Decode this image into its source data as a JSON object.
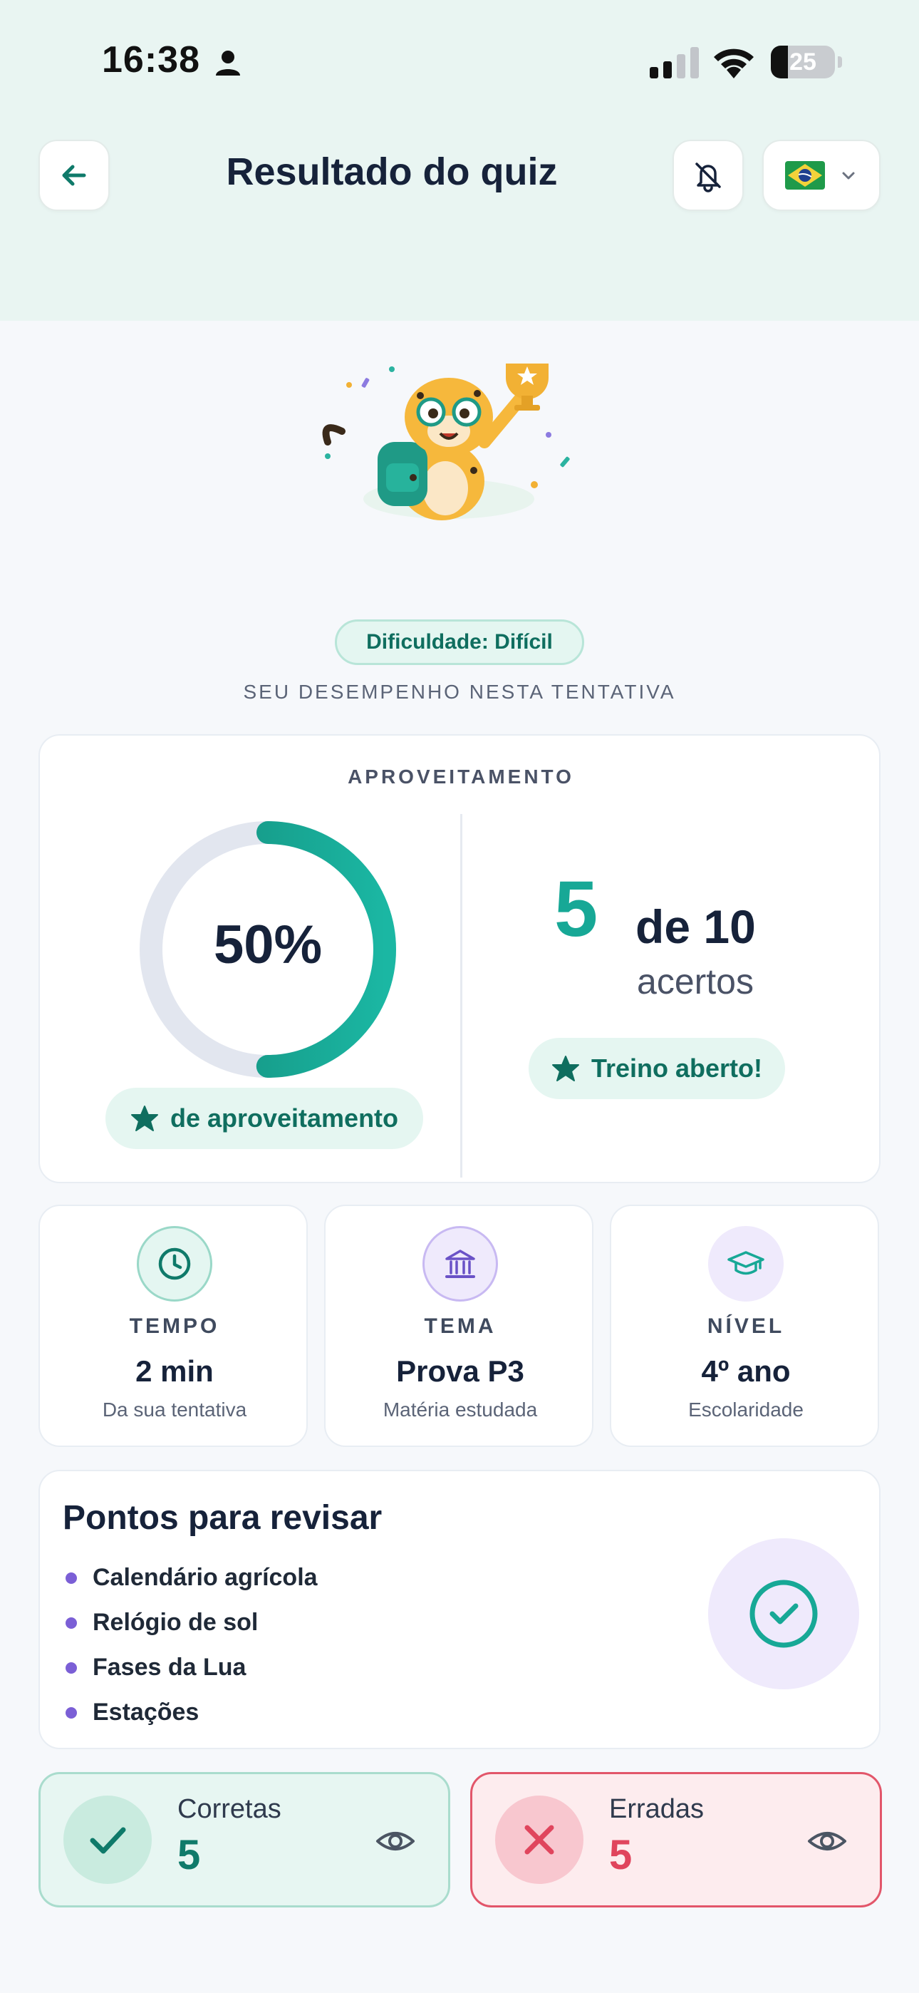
{
  "status_bar": {
    "time": "16:38",
    "battery": "25",
    "icons": [
      "person-icon",
      "signal-icon",
      "wifi-icon",
      "battery-icon"
    ]
  },
  "header": {
    "title": "Resultado do quiz",
    "back_icon": "arrow-left-icon",
    "notification_icon": "bell-off-icon",
    "language_flag": "brazil-flag-icon",
    "dropdown_icon": "chevron-down-icon"
  },
  "mascot": {
    "icon": "cheetah-mascot-with-trophy"
  },
  "difficulty": "Dificuldade: Difícil",
  "subtitle": "SEU DESEMPENHO NESTA TENTATIVA",
  "performance": {
    "label": "APROVEITAMENTO",
    "percent_text": "50%",
    "percent_value": 0.5,
    "percent_pill": "de aproveitamento",
    "correct": "5",
    "total": "de 10",
    "unit": "acertos",
    "status_pill": "Treino aberto!"
  },
  "stats": [
    {
      "label": "TEMPO",
      "value": "2 min",
      "sub": "Da sua tentativa",
      "icon": "clock-icon"
    },
    {
      "label": "TEMA",
      "value": "Prova P3",
      "sub": "Matéria estudada",
      "icon": "institution-icon"
    },
    {
      "label": "NÍVEL",
      "value": "4º ano",
      "sub": "Escolaridade",
      "icon": "graduation-cap-icon"
    }
  ],
  "review": {
    "title": "Pontos para revisar",
    "items": [
      "Calendário agrícola",
      "Relógio de sol",
      "Fases da Lua",
      "Estações"
    ],
    "icon": "check-circle-icon"
  },
  "results": {
    "correct": {
      "label": "Corretas",
      "count": "5",
      "icon": "check-icon"
    },
    "wrong": {
      "label": "Erradas",
      "count": "5",
      "icon": "x-icon"
    }
  },
  "colors": {
    "accent_teal": "#17a896",
    "dark_teal": "#0f6e5f",
    "error_red": "#e0455d",
    "purple": "#7b5fd6",
    "header_bg": "#e9f5f2"
  }
}
